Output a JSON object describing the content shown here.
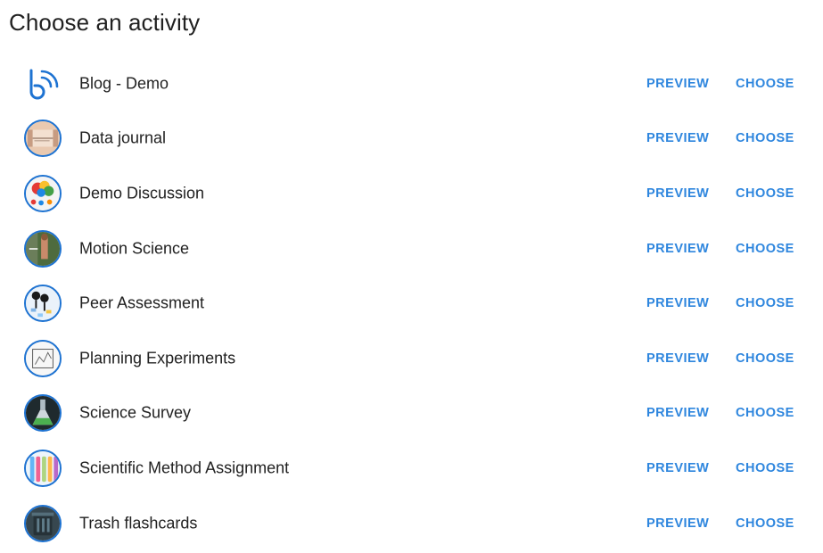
{
  "header": {
    "title": "Choose an activity"
  },
  "actions": {
    "preview_label": "PREVIEW",
    "choose_label": "CHOOSE"
  },
  "activities": [
    {
      "label": "Blog - Demo",
      "icon": "blog-logo-icon"
    },
    {
      "label": "Data journal",
      "icon": "data-journal-thumbnail"
    },
    {
      "label": "Demo Discussion",
      "icon": "discussion-thumbnail"
    },
    {
      "label": "Motion Science",
      "icon": "motion-science-thumbnail"
    },
    {
      "label": "Peer Assessment",
      "icon": "peer-assessment-thumbnail"
    },
    {
      "label": "Planning Experiments",
      "icon": "planning-experiments-thumbnail"
    },
    {
      "label": "Science Survey",
      "icon": "science-survey-thumbnail"
    },
    {
      "label": "Scientific Method Assignment",
      "icon": "scientific-method-thumbnail"
    },
    {
      "label": "Trash flashcards",
      "icon": "trash-flashcards-thumbnail"
    }
  ],
  "colors": {
    "accent": "#2e86de",
    "avatar_border": "#1e73d2",
    "text": "#212121"
  }
}
